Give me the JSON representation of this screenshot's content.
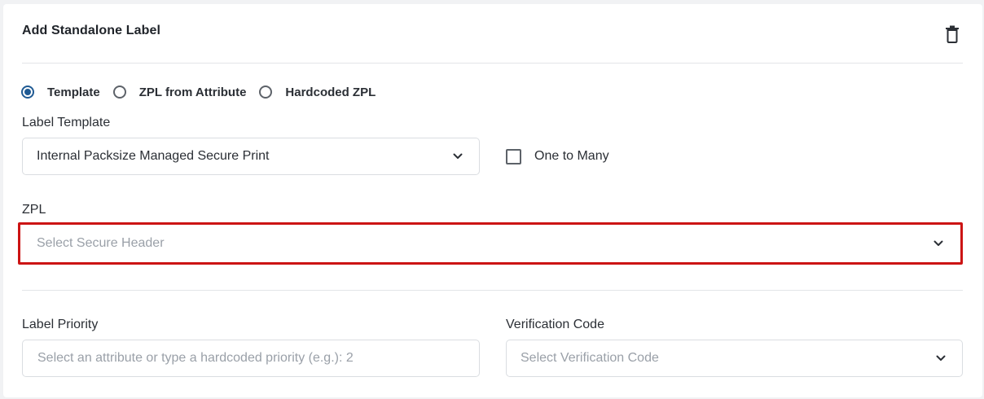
{
  "card": {
    "title": "Add Standalone Label",
    "delete_icon": "trash-icon"
  },
  "label_source": {
    "options": [
      {
        "label": "Template",
        "selected": true
      },
      {
        "label": "ZPL from Attribute",
        "selected": false
      },
      {
        "label": "Hardcoded ZPL",
        "selected": false
      }
    ]
  },
  "label_template": {
    "label": "Label Template",
    "value": "Internal Packsize Managed Secure Print"
  },
  "one_to_many": {
    "label": "One to Many",
    "checked": false
  },
  "zpl": {
    "label": "ZPL",
    "placeholder": "Select Secure Header"
  },
  "label_priority": {
    "label": "Label Priority",
    "placeholder": "Select an attribute or type a hardcoded priority (e.g.): 2"
  },
  "verification_code": {
    "label": "Verification Code",
    "placeholder": "Select Verification Code"
  },
  "colors": {
    "accent": "#1f5a93",
    "highlight": "#cc1414",
    "placeholder": "#9aa0a8",
    "border": "#dadde1"
  }
}
